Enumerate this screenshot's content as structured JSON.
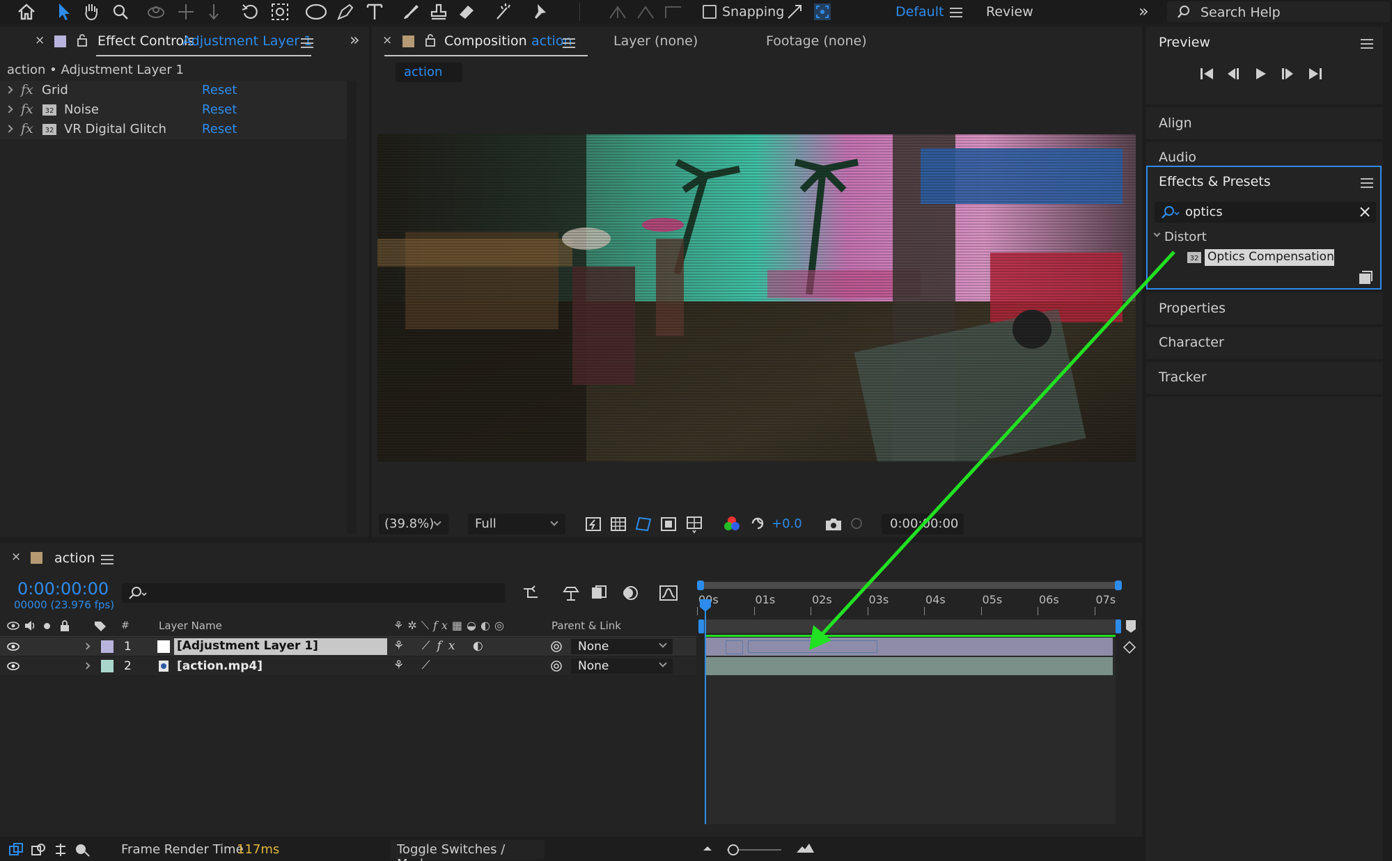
{
  "toolbar": {
    "snapping_label": "Snapping",
    "workspace_default": "Default",
    "workspace_review": "Review",
    "search_placeholder": "Search Help"
  },
  "effect_controls": {
    "tab_title": "Effect Controls",
    "tab_layer": "Adjustment Layer 1",
    "breadcrumb": "action • Adjustment Layer 1",
    "effects": [
      {
        "name": "Grid",
        "reset": "Reset"
      },
      {
        "name": "Noise",
        "reset": "Reset"
      },
      {
        "name": "VR Digital Glitch",
        "reset": "Reset"
      }
    ]
  },
  "composition": {
    "tab_title": "Composition",
    "tab_name": "action",
    "layer_tab": "Layer (none)",
    "footage_tab": "Footage (none)",
    "comp_chip": "action",
    "zoom": "(39.8%)",
    "resolution": "Full",
    "exposure": "+0.0",
    "timecode": "0:00:00:00"
  },
  "right_panels": {
    "preview": "Preview",
    "align": "Align",
    "audio": "Audio",
    "effects_presets": "Effects & Presets",
    "search_value": "optics",
    "category": "Distort",
    "effect_item": "Optics Compensation",
    "properties": "Properties",
    "character": "Character",
    "tracker": "Tracker"
  },
  "timeline": {
    "comp_name": "action",
    "current_time": "0:00:00:00",
    "frame_info": "00000 (23.976 fps)",
    "col_hash": "#",
    "col_layer_name": "Layer Name",
    "col_parent": "Parent & Link",
    "ruler": [
      "00s",
      "01s",
      "02s",
      "03s",
      "04s",
      "05s",
      "06s",
      "07s"
    ],
    "layers": [
      {
        "num": "1",
        "name": "[Adjustment Layer 1]",
        "parent": "None",
        "label_color": "#b9b4dd"
      },
      {
        "num": "2",
        "name": "[action.mp4]",
        "parent": "None",
        "label_color": "#a9d7cc"
      }
    ],
    "render_time_label": "Frame Render Time",
    "render_time_value": "117ms",
    "toggle_label": "Toggle Switches / Modes"
  },
  "colors": {
    "accent": "#2d8ceb",
    "arrow": "#22e022",
    "render_time": "#e3b73c"
  }
}
